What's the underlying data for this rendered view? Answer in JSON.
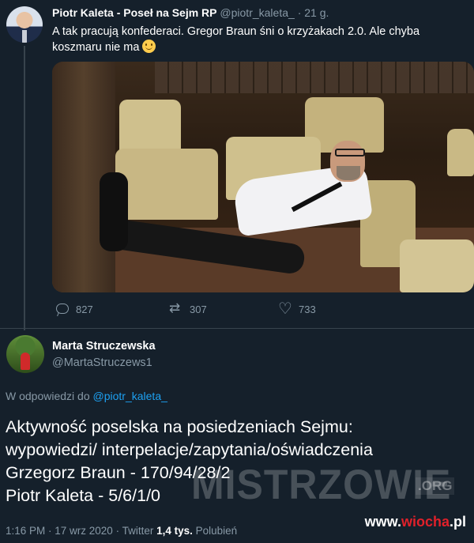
{
  "tweet": {
    "author_name": "Piotr Kaleta - Poseł na Sejm RP",
    "author_handle": "@piotr_kaleta_",
    "time_ago": "· 21 g.",
    "text": "A tak pracują konfederaci. Gregor Braun śni o krzyżakach 2.0. Ale chyba koszmaru nie ma",
    "emoji": "slightly-smiling-face",
    "actions": {
      "replies": "827",
      "retweets": "307",
      "likes": "733"
    }
  },
  "reply": {
    "author_name": "Marta Struczewska",
    "author_handle": "@MartaStruczews1",
    "reply_to_prefix": "W odpowiedzi do",
    "reply_to_handle": "@piotr_kaleta_",
    "lines": [
      "Aktywność poselska na posiedzeniach Sejmu:",
      "wypowiedzi/ interpelacje/zapytania/oświadczenia",
      "Grzegorz Braun - 170/94/28/2",
      "Piotr Kaleta - 5/6/1/0"
    ],
    "meta_prefix": "1:16 PM · 17 wrz 2020 · Twitter",
    "likes_count": "1,4 tys.",
    "likes_label": "Polubień"
  },
  "watermark": {
    "text": "MISTRZOWIE",
    "suffix": ".ORG"
  },
  "site_mark": {
    "prefix": "www.",
    "name": "wiocha",
    "suffix": ".pl"
  },
  "colors": {
    "background": "#15202b",
    "muted": "#8899a6",
    "link": "#1da1f2",
    "divider": "#38444d"
  }
}
